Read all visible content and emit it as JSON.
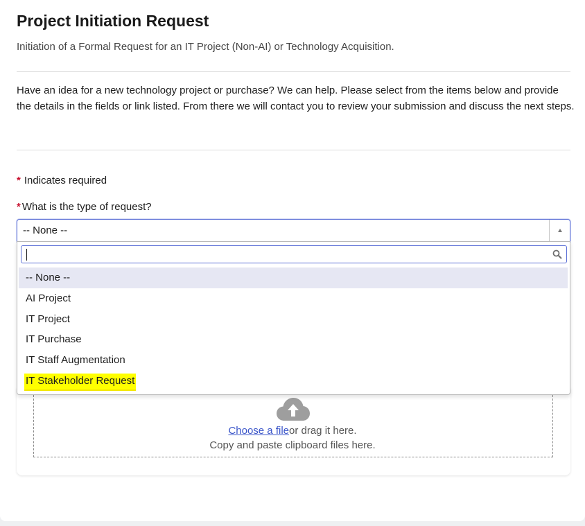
{
  "header": {
    "title": "Project Initiation Request",
    "subtitle": "Initiation of a Formal Request for an IT Project (Non-AI) or Technology Acquisition."
  },
  "intro": "Have an idea for a new technology project or purchase? We can help. Please select from the items below and provide the details in the fields or link listed. From there we will contact you to review your submission and discuss the next steps.",
  "required_note": {
    "marker": "*",
    "text": "Indicates required"
  },
  "question": {
    "marker": "*",
    "label": "What is the type of request?",
    "selected_value": "-- None --",
    "search_placeholder": "",
    "options": [
      "-- None --",
      "AI Project",
      "IT Project",
      "IT Purchase",
      "IT Staff Augmentation",
      "IT Stakeholder Request"
    ],
    "highlighted_option": "IT Stakeholder Request"
  },
  "attachment": {
    "link_text": "Choose a file",
    "drag_text": "or drag it here.",
    "paste_text": "Copy and paste clipboard files here."
  },
  "icons": {
    "upload": "cloud-upload-icon",
    "search": "magnifier-icon",
    "dropdown_arrow": "caret-up-icon"
  },
  "colors": {
    "required": "#c8102e",
    "focus": "#5b6fd6",
    "link": "#3a55c9",
    "highlight": "#ffff00",
    "selected_row": "#e6e7f3"
  }
}
